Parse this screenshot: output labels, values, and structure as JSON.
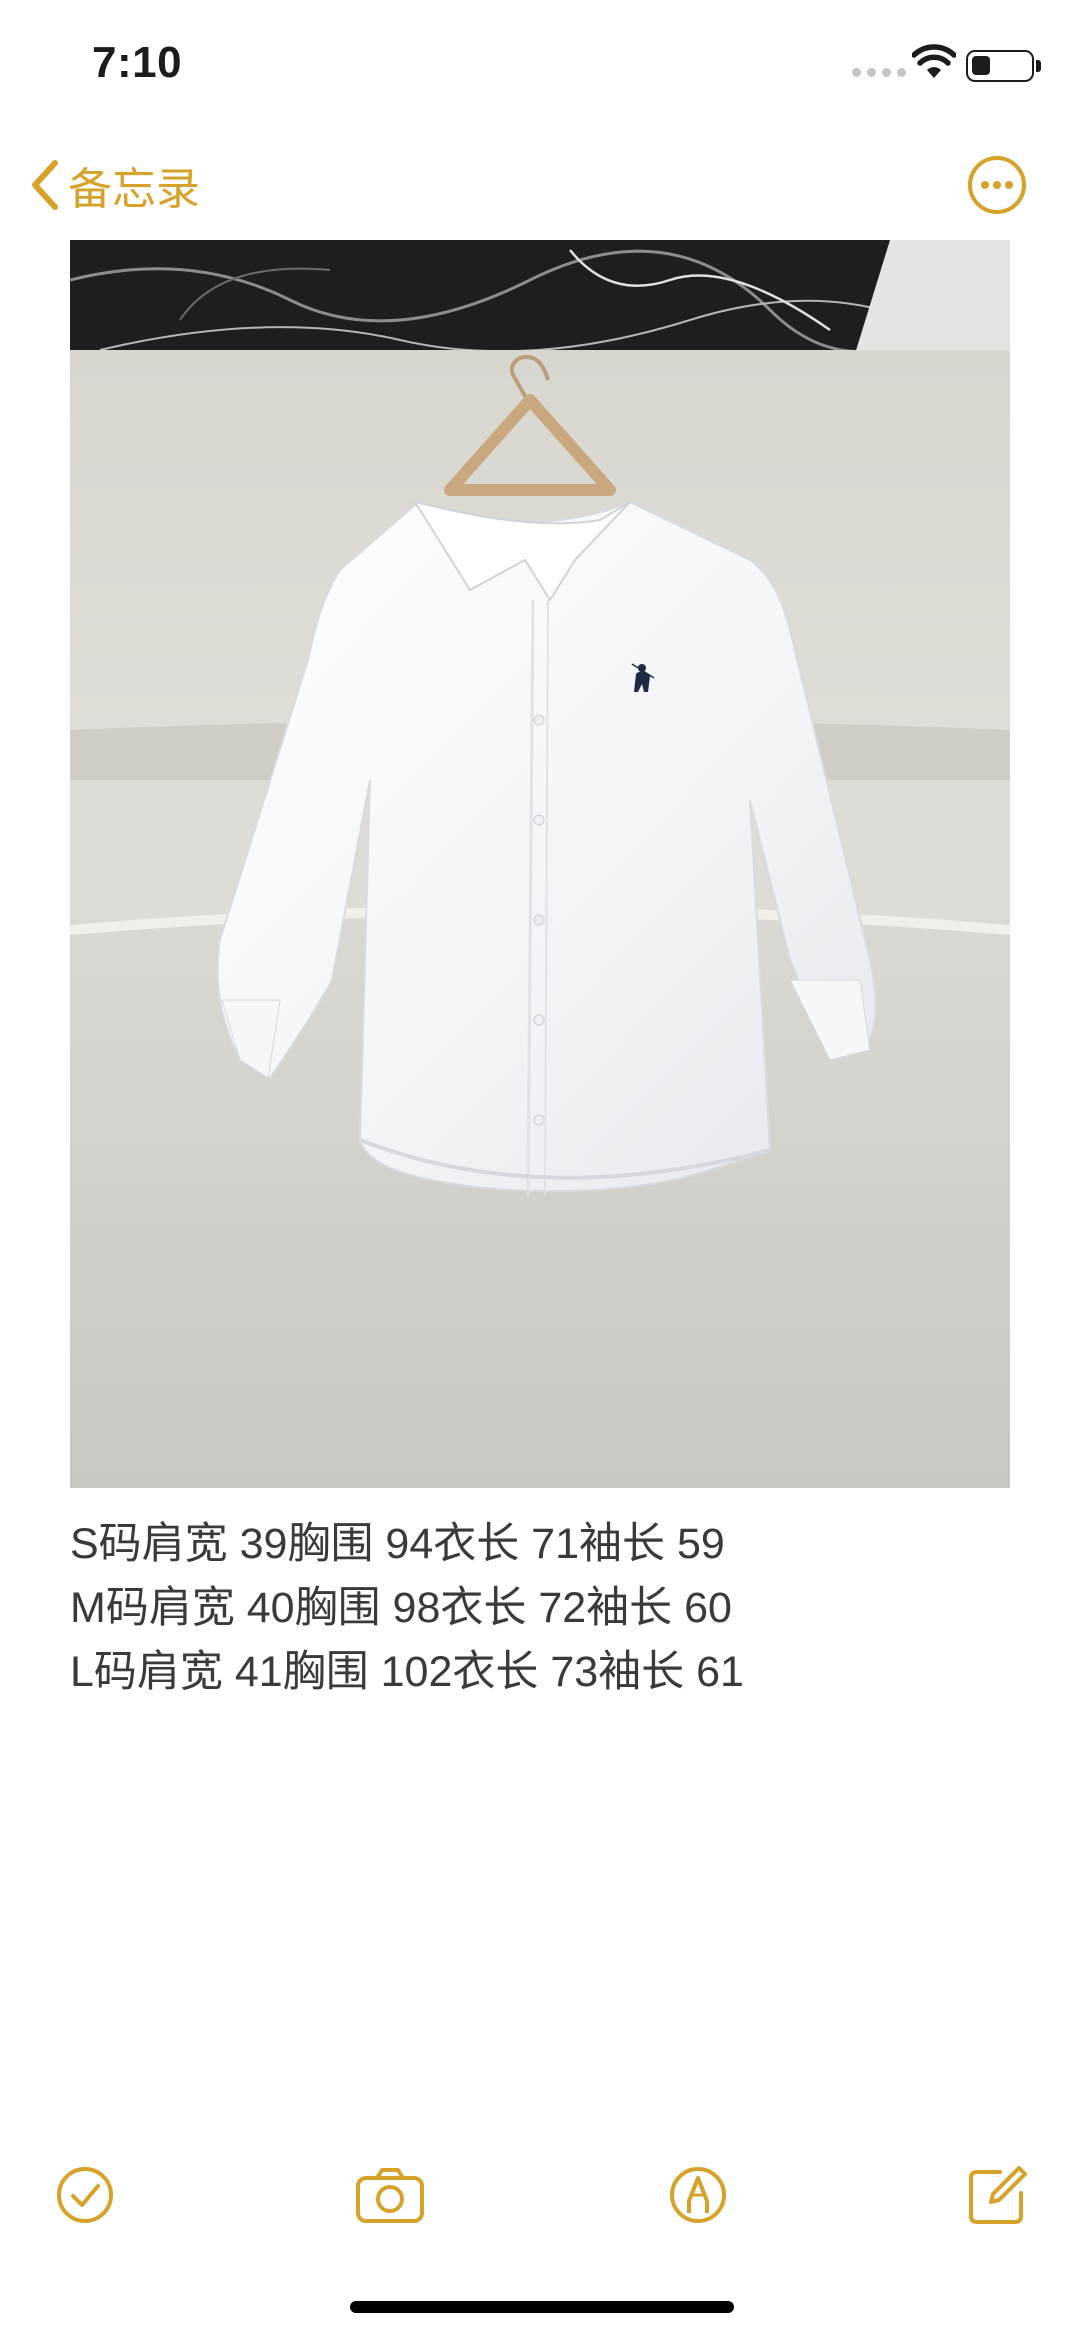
{
  "status_bar": {
    "time": "7:10"
  },
  "nav": {
    "back_label": "备忘录"
  },
  "note": {
    "lines": [
      "S码肩宽 39胸围 94衣长 71袖长 59",
      "M码肩宽 40胸围 98衣长 72袖长 60",
      "L码肩宽 41胸围 102衣长 73袖长 61"
    ]
  },
  "colors": {
    "accent": "#d6a22a",
    "text": "#3a3a3c",
    "background": "#ffffff"
  },
  "toolbar": {
    "items": [
      "checklist-icon",
      "camera-icon",
      "markup-icon",
      "compose-icon"
    ]
  }
}
